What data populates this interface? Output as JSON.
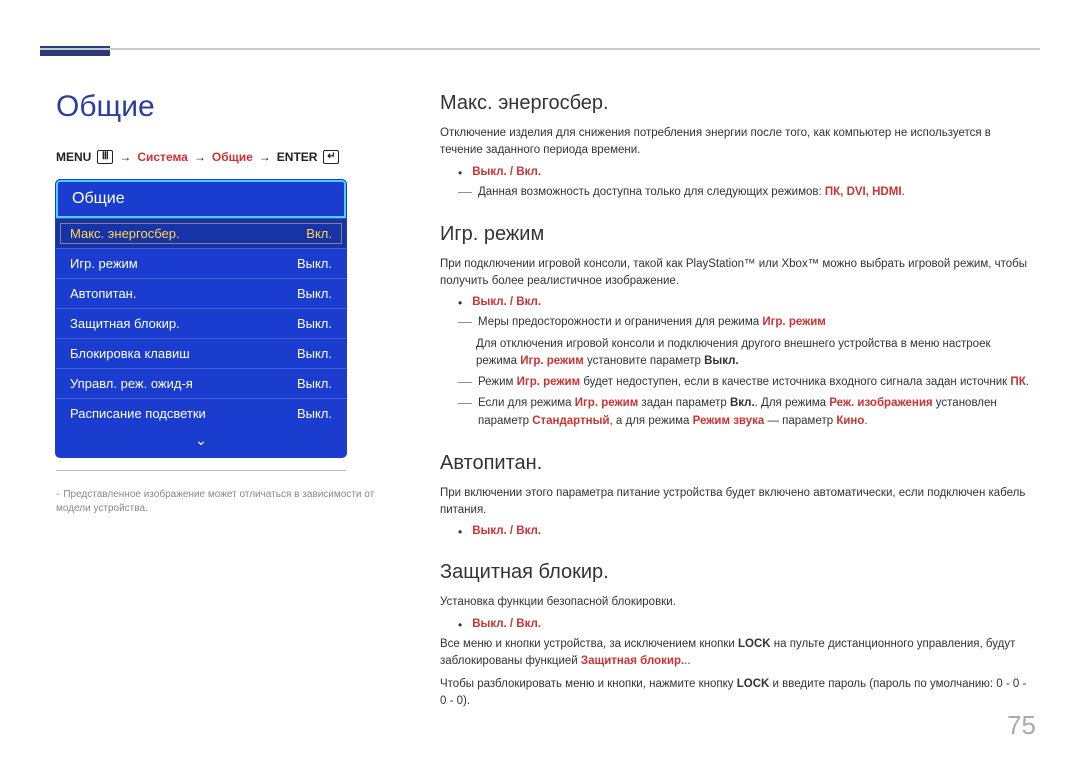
{
  "pageTitle": "Общие",
  "breadcrumb": {
    "menu": "MENU",
    "menuGlyph": "Ⅲ",
    "arrow": "→",
    "system": "Система",
    "general": "Общие",
    "enter": "ENTER",
    "enterGlyph": "↵"
  },
  "menu": {
    "header": "Общие",
    "rows": [
      {
        "label": "Макс. энергосбер.",
        "value": "Вкл.",
        "selected": true
      },
      {
        "label": "Игр. режим",
        "value": "Выкл."
      },
      {
        "label": "Автопитан.",
        "value": "Выкл."
      },
      {
        "label": "Защитная блокир.",
        "value": "Выкл."
      },
      {
        "label": "Блокировка клавиш",
        "value": "Выкл."
      },
      {
        "label": "Управл. реж. ожид-я",
        "value": "Выкл."
      },
      {
        "label": "Расписание подсветки",
        "value": "Выкл."
      }
    ],
    "more": "⌄"
  },
  "menuNote": "Представленное изображение может отличаться в зависимости от модели устройства.",
  "sections": {
    "maxEnergy": {
      "title": "Макс. энергосбер.",
      "desc": "Отключение изделия для снижения потребления энергии после того, как компьютер не используется в течение заданного периода времени.",
      "opt": "Выкл. / Вкл.",
      "note1_pre": "Данная возможность доступна только для следующих режимов: ",
      "note1_modes": "ПК, DVI, HDMI",
      "note1_post": "."
    },
    "gameMode": {
      "title": "Игр. режим",
      "desc": "При подключении игровой консоли, такой как PlayStation™ или Xbox™ можно выбрать игровой режим, чтобы получить более реалистичное изображение.",
      "opt": "Выкл. / Вкл.",
      "n1_pre": "Меры предосторожности и ограничения для режима ",
      "n1_hl": "Игр. режим",
      "n2_pre": "Для отключения игровой консоли и подключения другого внешнего устройства в меню настроек режима ",
      "n2_hl": "Игр. режим",
      "n2_mid": " установите параметр ",
      "n2_b": "Выкл.",
      "n3_pre": "Режим ",
      "n3_hl": "Игр. режим",
      "n3_mid": " будет недоступен, если в качестве источника входного сигнала задан источник ",
      "n3_hl2": "ПК",
      "n3_post": ".",
      "n4_pre": "Если для режима ",
      "n4_hl": "Игр. режим",
      "n4_mid1": " задан параметр ",
      "n4_b1": "Вкл.",
      "n4_mid2": ". Для режима ",
      "n4_hl2": "Реж. изображения",
      "n4_mid3": " установлен параметр ",
      "n4_hl3": "Стандартный",
      "n4_mid4": ", а для режима ",
      "n4_hl4": "Режим звука",
      "n4_mid5": " — параметр ",
      "n4_hl5": "Кино",
      "n4_post": "."
    },
    "autoPower": {
      "title": "Автопитан.",
      "desc": "При включении этого параметра питание устройства будет включено автоматически, если подключен кабель питания.",
      "opt": "Выкл. / Вкл."
    },
    "safetyLock": {
      "title": "Защитная блокир.",
      "desc": "Установка функции безопасной блокировки.",
      "opt": "Выкл. / Вкл.",
      "p2_pre": "Все меню и кнопки устройства, за исключением кнопки ",
      "p2_b": "LOCK",
      "p2_mid": " на пульте дистанционного управления, будут заблокированы функцией ",
      "p2_hl": "Защитная блокир.",
      "p2_post": "..",
      "p3_pre": "Чтобы разблокировать меню и кнопки, нажмите кнопку ",
      "p3_b": "LOCK",
      "p3_post": " и введите пароль (пароль по умолчанию: 0 - 0 - 0 - 0)."
    }
  },
  "pageNumber": "75"
}
